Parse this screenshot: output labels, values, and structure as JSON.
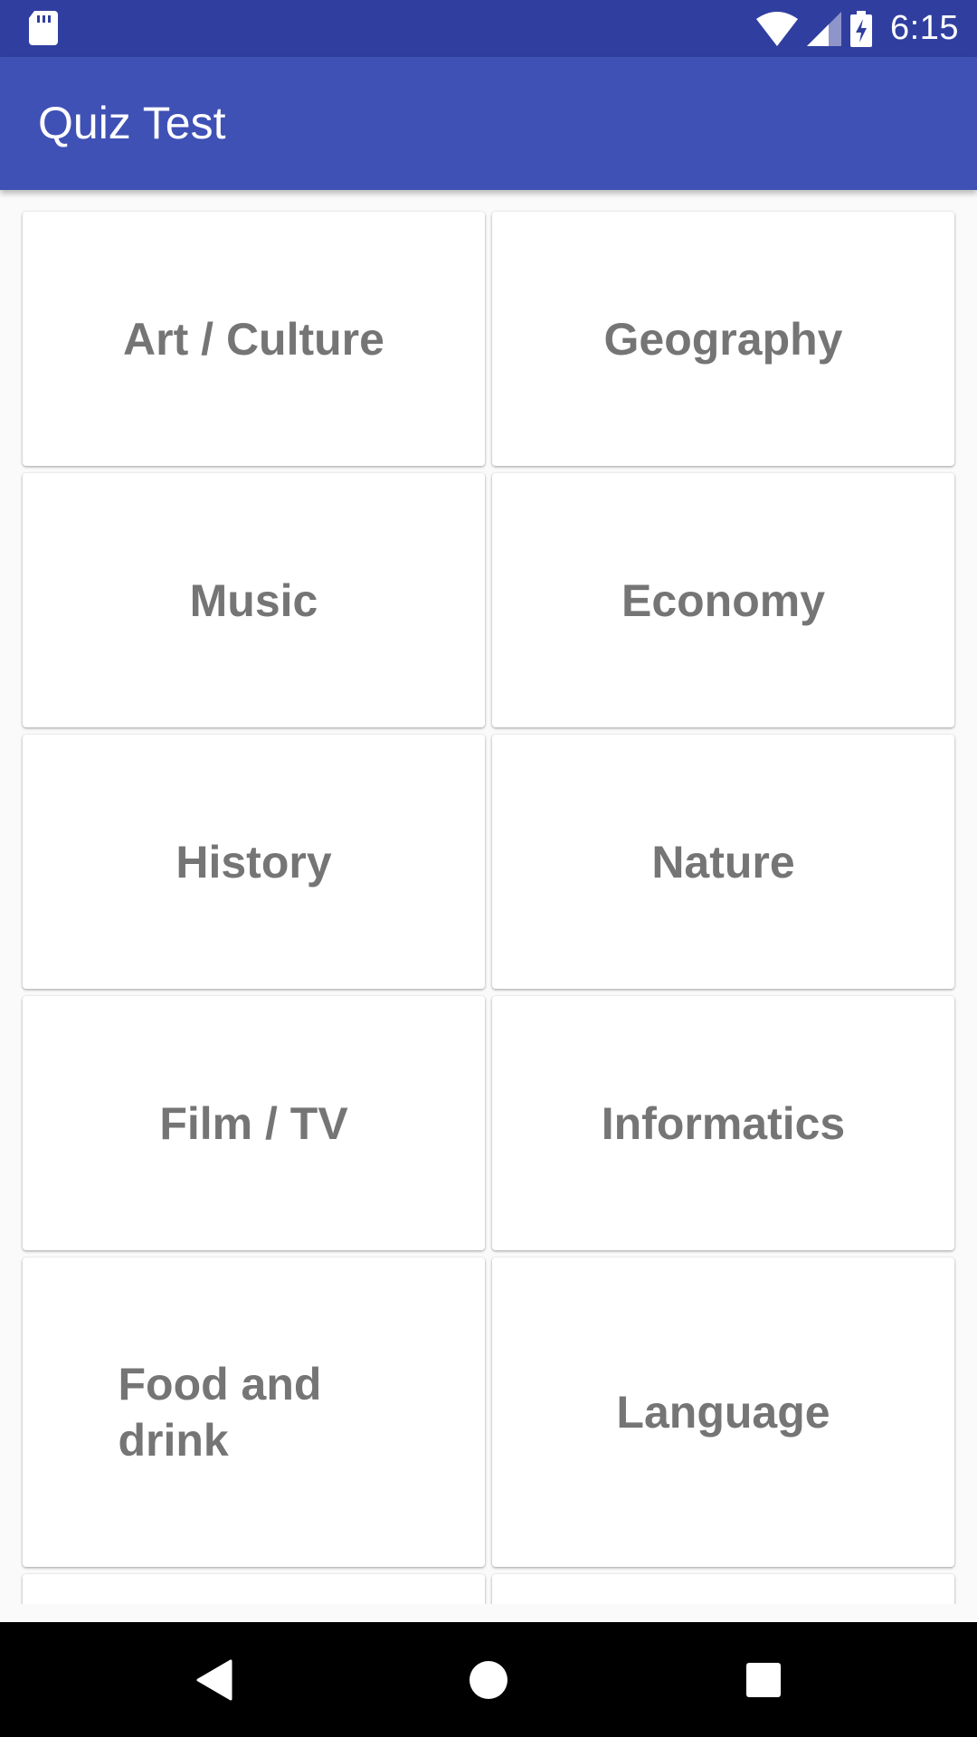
{
  "status_bar": {
    "time": "6:15",
    "icons": [
      "sd-card-icon",
      "wifi-icon",
      "signal-icon",
      "battery-charging-icon"
    ]
  },
  "app_bar": {
    "title": "Quiz Test"
  },
  "categories": [
    {
      "label": "Art / Culture"
    },
    {
      "label": "Geography"
    },
    {
      "label": "Music"
    },
    {
      "label": "Economy"
    },
    {
      "label": "History"
    },
    {
      "label": "Nature"
    },
    {
      "label": "Film / TV"
    },
    {
      "label": "Informatics"
    },
    {
      "label": "Food and drink"
    },
    {
      "label": "Language"
    }
  ],
  "nav_bar": {
    "buttons": [
      "back-icon",
      "home-icon",
      "recents-icon"
    ]
  },
  "colors": {
    "status_bar": "#303f9f",
    "app_bar": "#3f51b5",
    "card_text": "#757575",
    "background": "#fafafa"
  }
}
